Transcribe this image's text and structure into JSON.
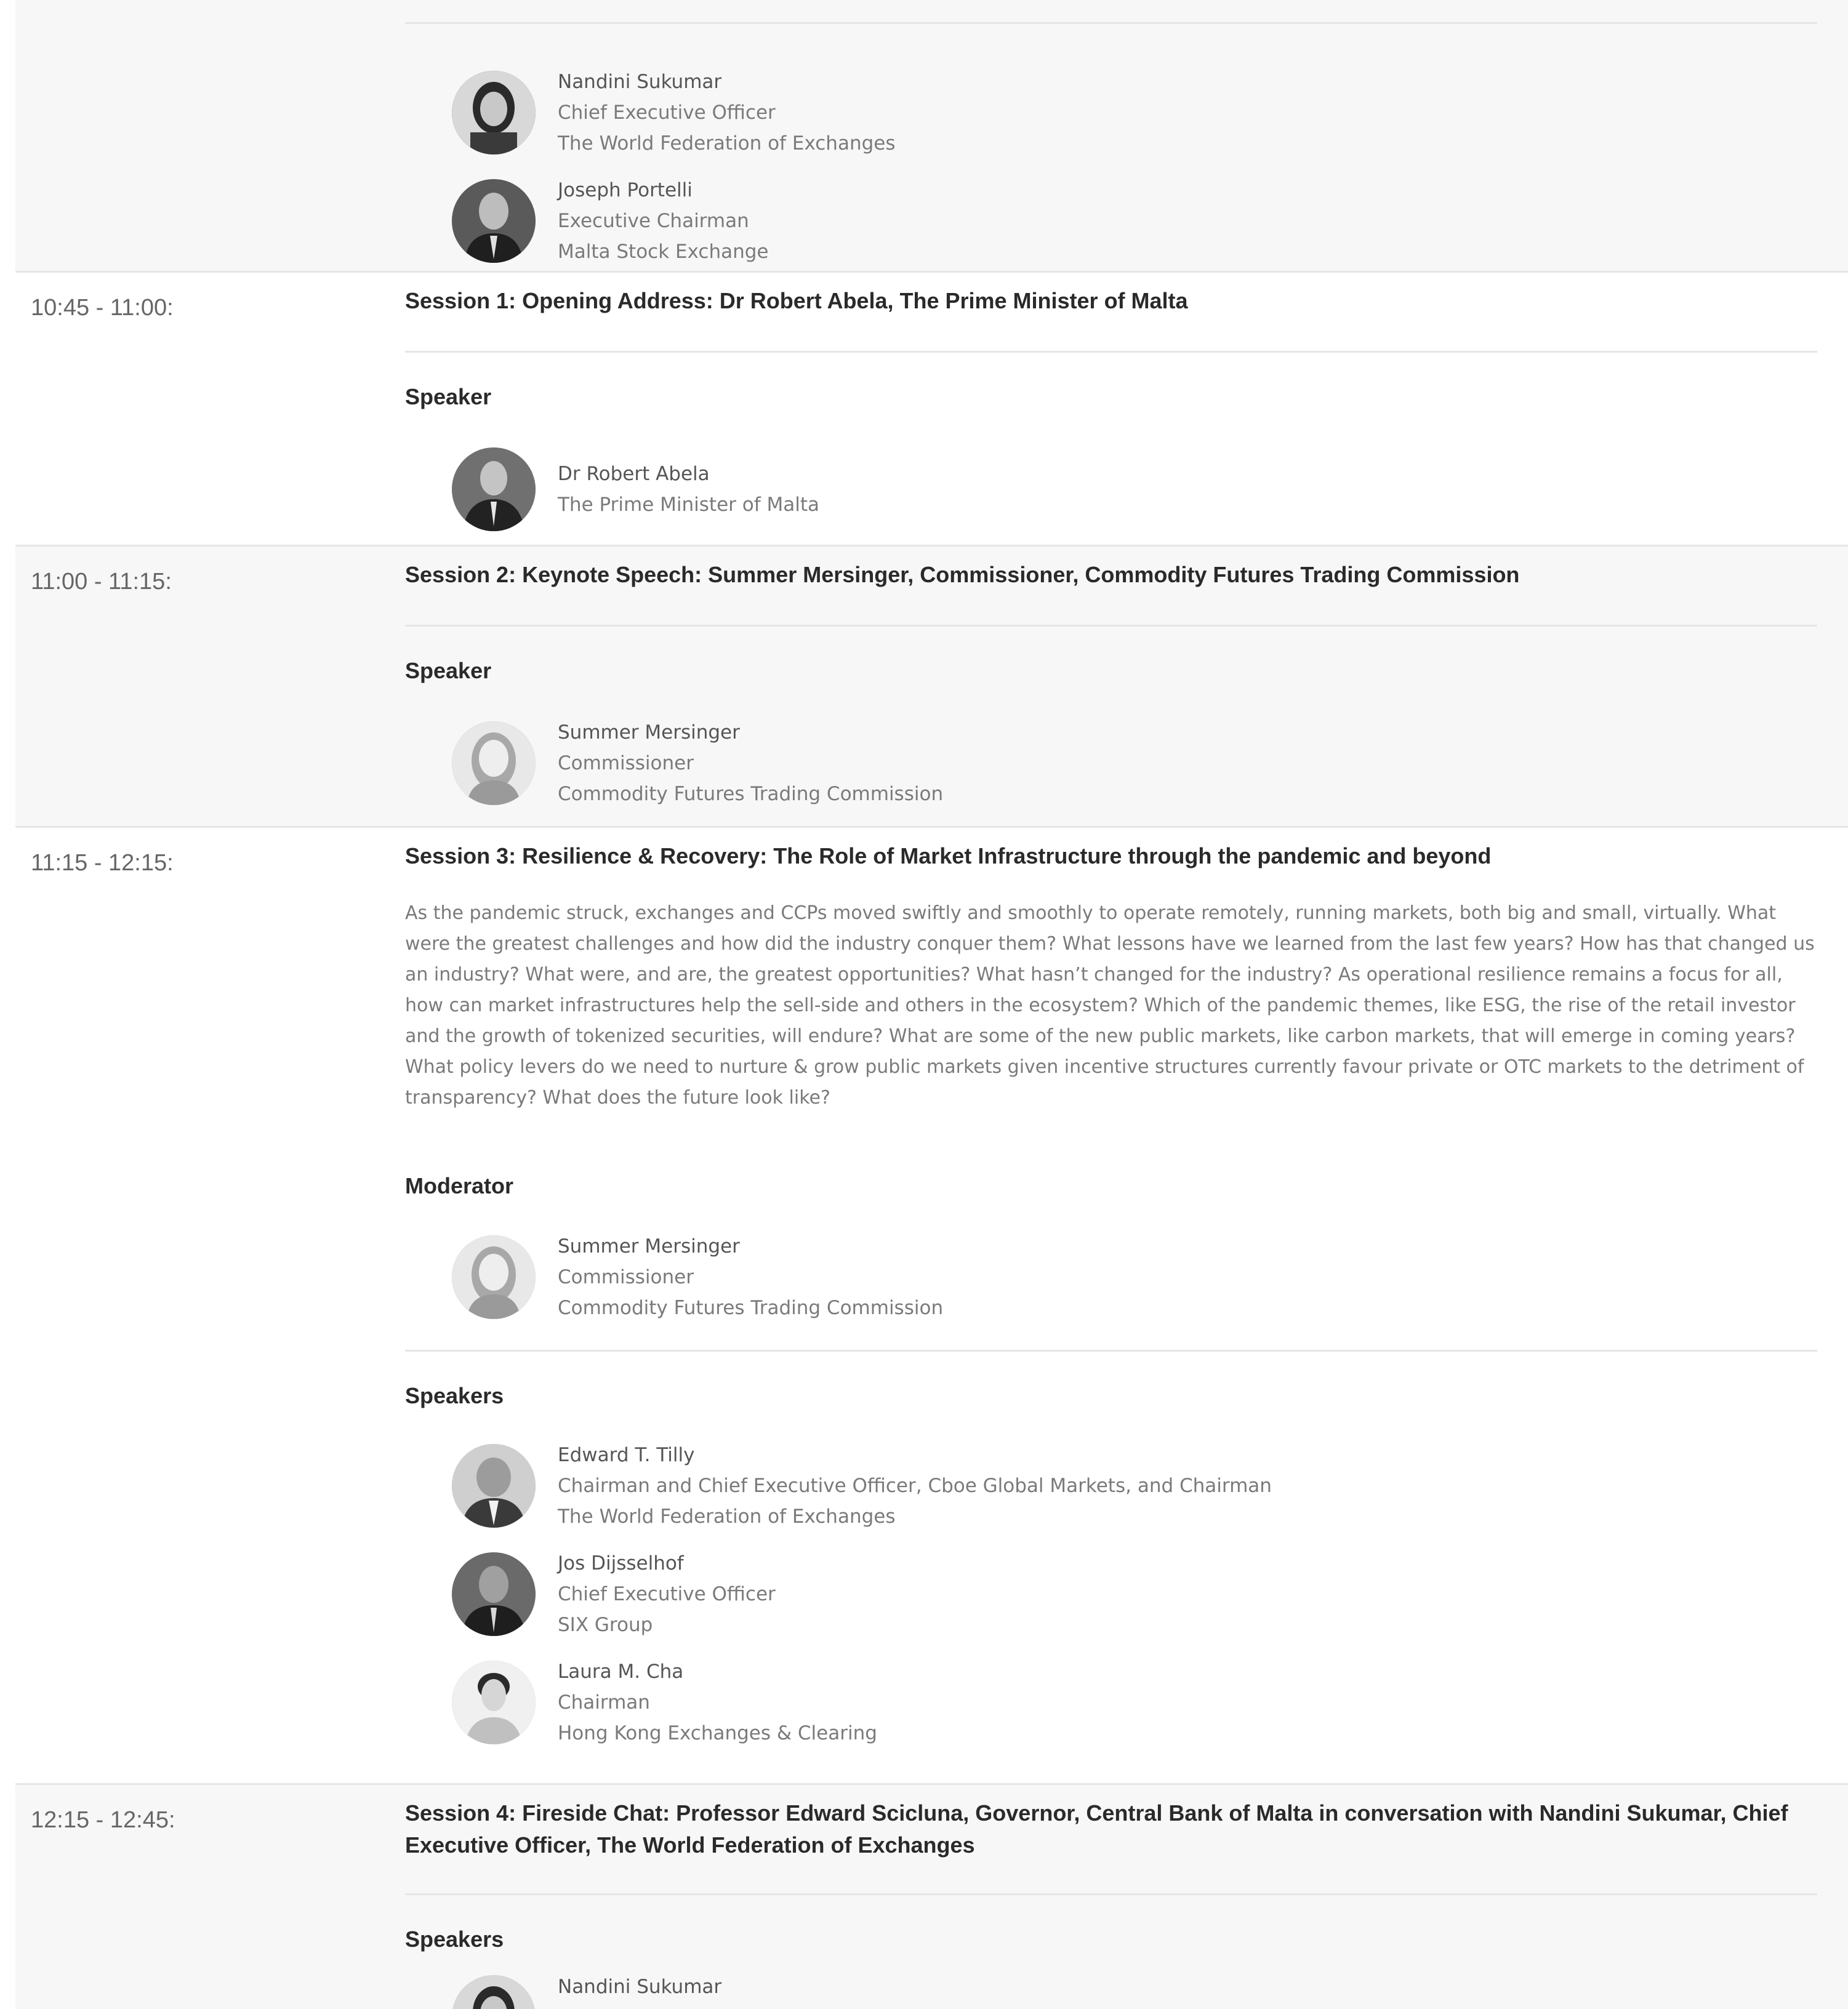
{
  "previous_session": {
    "speakers": [
      {
        "name": "Nandini Sukumar",
        "title": "Chief Executive Officer",
        "org": "The World Federation of Exchanges",
        "avatar_tone": "#4a4a4a"
      },
      {
        "name": "Joseph Portelli",
        "title": "Executive Chairman",
        "org": "Malta Stock Exchange",
        "avatar_tone": "#3a3a3a"
      }
    ]
  },
  "sessions": [
    {
      "time": "10:45 - 11:00:",
      "title": "Session 1: Opening Address: Dr Robert Abela, The Prime Minister of Malta",
      "groups": [
        {
          "label": "Speaker",
          "people": [
            {
              "name": "Dr Robert Abela",
              "lines": [
                "The Prime Minister of Malta"
              ],
              "avatar_tone": "#3d3d3d"
            }
          ]
        }
      ]
    },
    {
      "time": "11:00 - 11:15:",
      "title": "Session 2: Keynote Speech: Summer Mersinger, Commissioner, Commodity Futures Trading Commission",
      "groups": [
        {
          "label": "Speaker",
          "people": [
            {
              "name": "Summer Mersinger",
              "lines": [
                "Commissioner",
                "Commodity Futures Trading Commission"
              ],
              "avatar_tone": "#b5b5b5"
            }
          ]
        }
      ]
    },
    {
      "time": "11:15 - 12:15:",
      "title": "Session 3: Resilience & Recovery: The Role of Market Infrastructure through the pandemic and beyond",
      "description": "As the pandemic struck, exchanges and CCPs moved swiftly and smoothly to operate remotely, running markets, both big and small, virtually. What were the greatest challenges and how did the industry conquer them? What lessons have we learned from the last few years? How has that changed us an industry? What were, and are, the greatest opportunities? What hasn’t changed for the industry? As operational resilience remains a focus for all, how can market infrastructures help the sell-side and others in the ecosystem? Which of the pandemic themes, like ESG, the rise of the retail investor and the growth of tokenized securities, will endure? What are some of the new public markets, like carbon markets, that will emerge in coming years? What policy levers do we need to nurture & grow public markets given incentive structures currently favour private or OTC markets to the detriment of transparency? What does the future look like?",
      "groups": [
        {
          "label": "Moderator",
          "people": [
            {
              "name": "Summer Mersinger",
              "lines": [
                "Commissioner",
                "Commodity Futures Trading Commission"
              ],
              "avatar_tone": "#b5b5b5"
            }
          ]
        },
        {
          "label": "Speakers",
          "people": [
            {
              "name": "Edward T. Tilly",
              "lines": [
                "Chairman and Chief Executive Officer, Cboe Global Markets, and Chairman",
                "The World Federation of Exchanges"
              ],
              "avatar_tone": "#8a8a8a"
            },
            {
              "name": "Jos Dijsselhof",
              "lines": [
                "Chief Executive Officer",
                "SIX Group"
              ],
              "avatar_tone": "#3e3e3e"
            },
            {
              "name": "Laura M. Cha",
              "lines": [
                "Chairman",
                "Hong Kong Exchanges & Clearing"
              ],
              "avatar_tone": "#d0d0d0"
            }
          ]
        }
      ]
    },
    {
      "time": "12:15 - 12:45:",
      "title": "Session 4: Fireside Chat: Professor Edward Scicluna, Governor, Central Bank of Malta in conversation with Nandini Sukumar, Chief Executive Officer, The World Federation of Exchanges",
      "groups": [
        {
          "label": "Speakers",
          "people": [
            {
              "name": "Nandini Sukumar",
              "lines": [],
              "avatar_tone": "#4a4a4a"
            }
          ]
        }
      ]
    }
  ]
}
